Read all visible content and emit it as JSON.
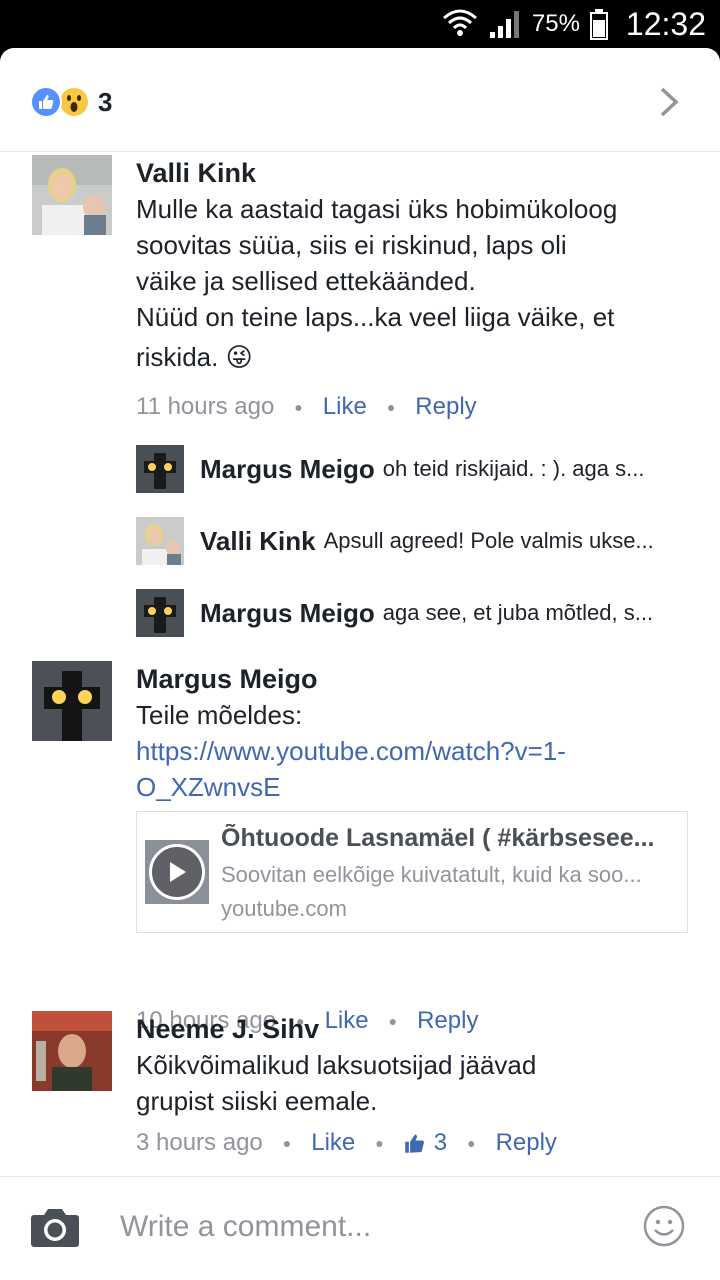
{
  "status_bar": {
    "battery": "75%",
    "time": "12:32"
  },
  "header": {
    "reaction_count": "3"
  },
  "comments": [
    {
      "name": "Valli Kink",
      "text_lines": [
        "Mulle ka aastaid tagasi üks hobimükoloog",
        "soovitas süüa, siis ei riskinud, laps oli",
        "väike ja sellised ettekäänded.",
        "Nüüd on teine laps...ka veel liiga väike, et",
        "riskida. 😜"
      ],
      "time": "11 hours ago",
      "like": "Like",
      "reply": "Reply"
    },
    {
      "name": "Margus Meigo",
      "text_lines": [
        "Teile mõeldes:"
      ],
      "link_lines": [
        "https://www.youtube.com/watch?v=1-",
        "O_XZwnvsE"
      ],
      "link_card": {
        "title": "Õhtuoode Lasnamäel ( #kärbsesee...",
        "description": "Soovitan eelkõige kuivatatult, kuid ka soo...",
        "domain": "youtube.com"
      },
      "time": "10 hours ago",
      "like": "Like",
      "reply": "Reply"
    },
    {
      "name": "Neeme J. Sihv",
      "text_lines": [
        "Kõikvõimalikud laksuotsijad jäävad",
        "grupist siiski eemale."
      ],
      "time": "3 hours ago",
      "like": "Like",
      "like_count": "3",
      "reply": "Reply"
    }
  ],
  "replies": [
    {
      "name": "Margus Meigo",
      "text": "oh teid riskijaid. : ). aga s..."
    },
    {
      "name": "Valli Kink",
      "text": "Apsull agreed! Pole valmis ukse..."
    },
    {
      "name": "Margus Meigo",
      "text": "aga see, et juba mõtled, s..."
    }
  ],
  "composer": {
    "placeholder": "Write a comment..."
  },
  "colors": {
    "link": "#4267b2",
    "meta": "#90949c",
    "text": "#1d2129",
    "like_blue": "#5890ff",
    "wow_yellow": "#f7c843"
  }
}
